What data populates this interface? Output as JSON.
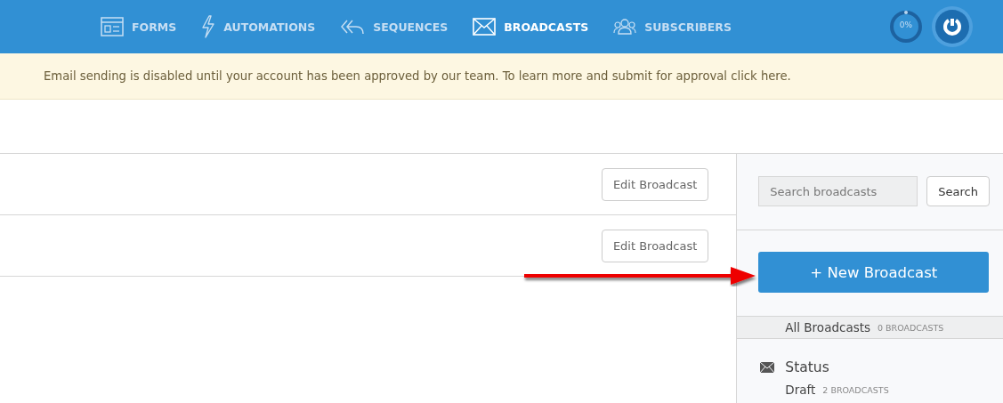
{
  "nav": [
    {
      "label": "FORMS",
      "selected": false
    },
    {
      "label": "AUTOMATIONS",
      "selected": false
    },
    {
      "label": "SEQUENCES",
      "selected": false
    },
    {
      "label": "BROADCASTS",
      "selected": true
    },
    {
      "label": "SUBSCRIBERS",
      "selected": false
    }
  ],
  "progress": {
    "reading": "0%",
    "level": 0
  },
  "banner": {
    "text": "Email sending is disabled until your account has been approved by our team. To learn more and submit for approval click here."
  },
  "broadcasts": [
    {
      "action": "Edit Broadcast"
    },
    {
      "action": "Edit Broadcast"
    }
  ],
  "sidebar": {
    "search": {
      "placeholder": "Search broadcasts",
      "button": "Search"
    },
    "new_button": "+ New Broadcast",
    "all": {
      "label": "All Broadcasts",
      "count": "0 BROADCASTS"
    },
    "status": {
      "title": "Status",
      "items": [
        {
          "label": "Draft",
          "count": "2 BROADCASTS"
        }
      ]
    }
  }
}
